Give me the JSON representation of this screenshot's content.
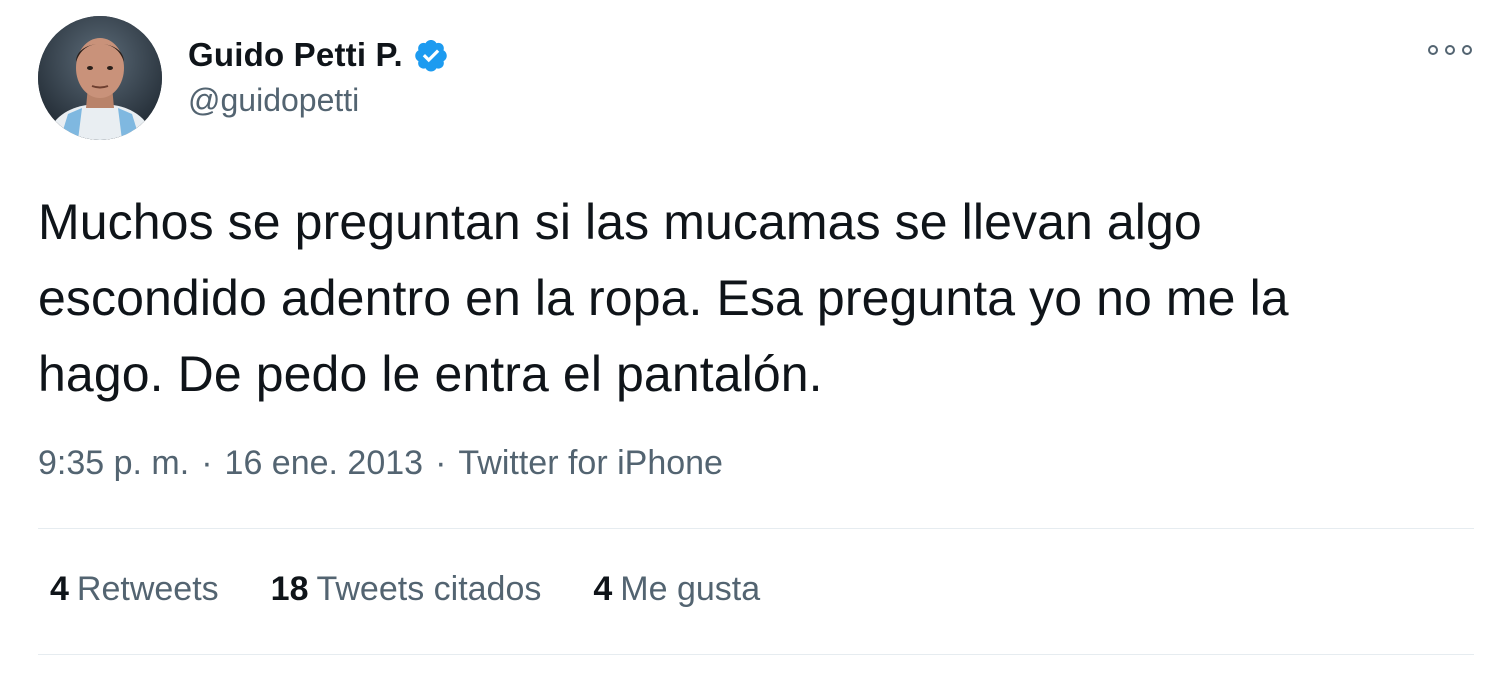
{
  "author": {
    "display_name": "Guido Petti P.",
    "handle": "@guidopetti",
    "verified_icon": "verified-badge-icon",
    "avatar": "profile-photo"
  },
  "tweet": {
    "text_lines": [
      "Muchos se preguntan si las mucamas se llevan algo",
      "escondido adentro en la ropa. Esa pregunta yo no me la",
      "hago. De pedo le entra el pantalón."
    ],
    "time": "9:35 p. m.",
    "separator": "·",
    "date": "16 ene. 2013",
    "source": "Twitter for iPhone"
  },
  "stats": {
    "retweets_count": "4",
    "retweets_label": "Retweets",
    "quotes_count": "18",
    "quotes_label": "Tweets citados",
    "likes_count": "4",
    "likes_label": "Me gusta"
  },
  "icons": {
    "more": "more-options-icon"
  },
  "colors": {
    "text_primary": "#0f1419",
    "text_secondary": "#536471",
    "verified_blue": "#1d9bf0",
    "divider": "#e6ecf0"
  }
}
